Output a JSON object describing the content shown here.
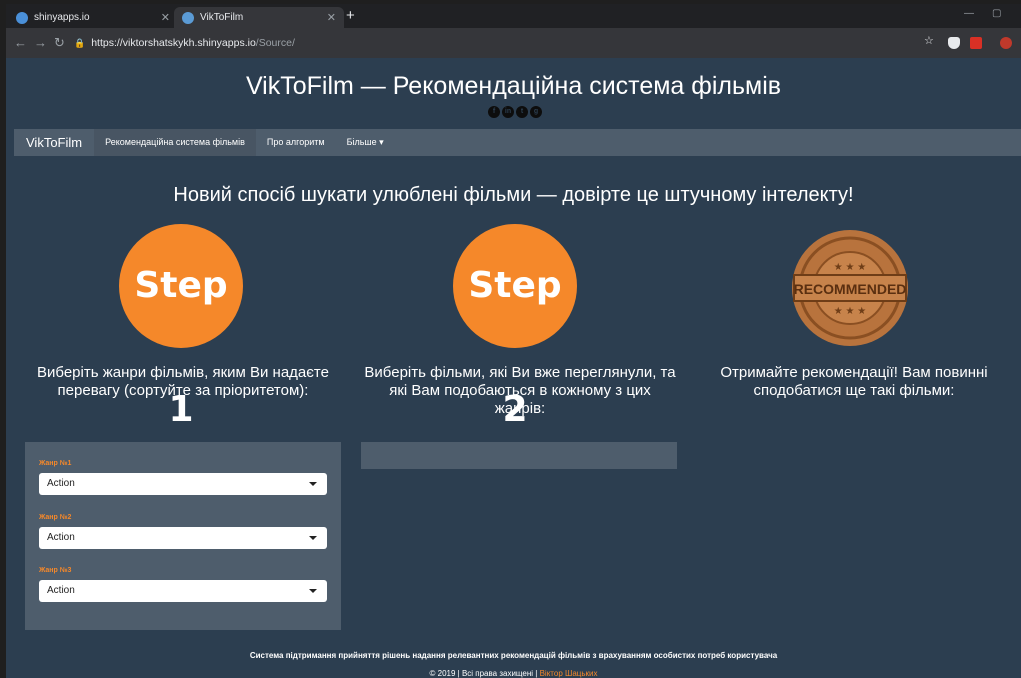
{
  "browser": {
    "tabs": [
      {
        "title": "shinyapps.io",
        "favicon_color": "#4a90d9"
      },
      {
        "title": "VikToFilm",
        "favicon_color": "#5b9bd5"
      }
    ],
    "url_host": "https://viktorshatskykh.shinyapps.io",
    "url_path": "/Source/"
  },
  "header": {
    "title": "VikToFilm — Рекомендаційна система фільмів"
  },
  "navbar": {
    "brand": "VikToFilm",
    "items": [
      {
        "label": "Рекомендаційна система фільмів"
      },
      {
        "label": "Про алгоритм"
      },
      {
        "label": "Більше ▾"
      }
    ]
  },
  "main": {
    "tagline": "Новий спосіб шукати улюблені фільми — довірте це штучному інтелекту!",
    "step1_label": "Step 1",
    "step2_label": "Step 2",
    "stamp_label": "RECOMMENDED",
    "col1_text": "Виберіть жанри фільмів, яким Ви надаєте перевагу (сортуйте за пріоритетом):",
    "col2_text": "Виберіть фільми, які Ви вже переглянули, та які Вам подобаються в кожному з цих жанрів:",
    "col3_text": "Отримайте рекомендації! Вам повинні сподобатися ще такі фільми:",
    "genres": [
      {
        "label": "Жанр №1",
        "value": "Action"
      },
      {
        "label": "Жанр №2",
        "value": "Action"
      },
      {
        "label": "Жанр №3",
        "value": "Action"
      }
    ]
  },
  "footer": {
    "line1": "Система підтримання прийняття рішень надання релевантних рекомендацій фільмів з врахуванням особистих потреб користувача",
    "copyright": "© 2019 | Всі права захищені |",
    "author": "Віктор Шацьких"
  },
  "colors": {
    "accent": "#f5882a",
    "background": "#2c3e50",
    "navbar": "#4e5d6c"
  }
}
